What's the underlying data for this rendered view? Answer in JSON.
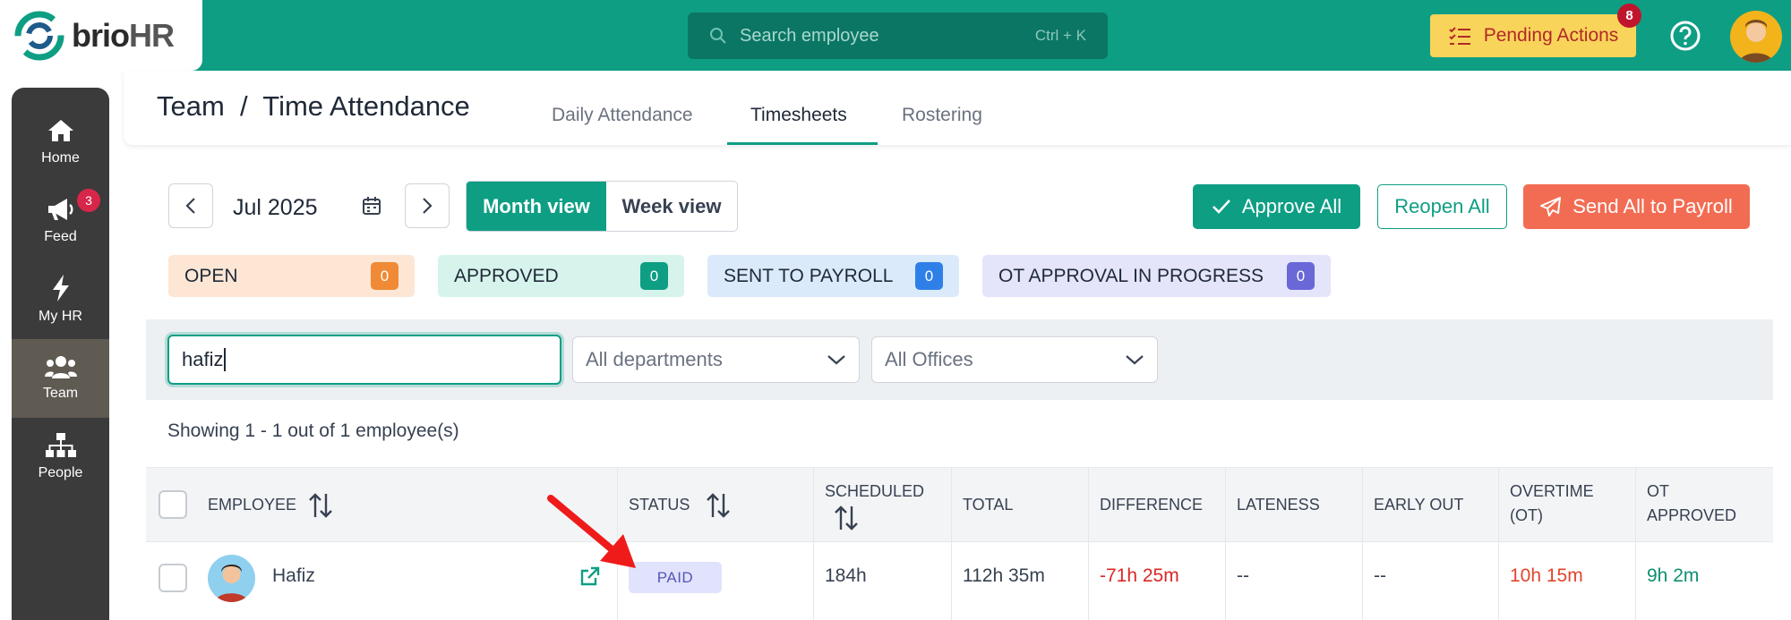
{
  "brand": {
    "name_left": "brio",
    "name_right": "HR",
    "colors": {
      "primary": "#0e9e84",
      "accent": "#f26c53",
      "warning": "#f9d45a"
    }
  },
  "topbar": {
    "search_placeholder": "Search employee",
    "search_shortcut": "Ctrl + K",
    "pending_label": "Pending Actions",
    "pending_count": "8"
  },
  "sidebar": {
    "items": [
      {
        "label": "Home",
        "icon": "home-icon"
      },
      {
        "label": "Feed",
        "icon": "megaphone-icon",
        "badge": "3"
      },
      {
        "label": "My HR",
        "icon": "bolt-icon"
      },
      {
        "label": "Team",
        "icon": "users-icon",
        "active": true
      },
      {
        "label": "People",
        "icon": "org-chart-icon"
      }
    ]
  },
  "header": {
    "breadcrumb": "Team  /  Time Attendance",
    "tabs": [
      {
        "label": "Daily Attendance"
      },
      {
        "label": "Timesheets",
        "active": true
      },
      {
        "label": "Rostering"
      }
    ]
  },
  "toolbar": {
    "month": "Jul 2025",
    "month_view": "Month view",
    "week_view": "Week view",
    "approve_all": "Approve All",
    "reopen_all": "Reopen All",
    "send_all": "Send All to Payroll"
  },
  "statuses": [
    {
      "label": "OPEN",
      "count": "0",
      "bg": "#fde6d4",
      "badge": "#f08a36"
    },
    {
      "label": "APPROVED",
      "count": "0",
      "bg": "#d6f3ec",
      "badge": "#0e9e84"
    },
    {
      "label": "SENT TO PAYROLL",
      "count": "0",
      "bg": "#dbeafb",
      "badge": "#2f7fe8"
    },
    {
      "label": "OT APPROVAL IN PROGRESS",
      "count": "0",
      "bg": "#e4e4fa",
      "badge": "#6a67d6"
    }
  ],
  "filters": {
    "search_value": "hafiz",
    "department": "All departments",
    "office": "All Offices"
  },
  "showing": "Showing 1 - 1 out of 1 employee(s)",
  "table": {
    "headers": {
      "employee": "EMPLOYEE",
      "status": "STATUS",
      "scheduled": "SCHEDULED",
      "total": "TOTAL",
      "difference": "DIFFERENCE",
      "lateness": "LATENESS",
      "early_out": "EARLY OUT",
      "overtime_1": "OVERTIME",
      "overtime_2": "(OT)",
      "ot_approved_1": "OT",
      "ot_approved_2": "APPROVED"
    },
    "rows": [
      {
        "name": "Hafiz",
        "status": "PAID",
        "scheduled": "184h",
        "total": "112h 35m",
        "difference": "-71h 25m",
        "lateness": "--",
        "early_out": "--",
        "overtime": "10h 15m",
        "ot_approved": "9h 2m"
      }
    ]
  }
}
